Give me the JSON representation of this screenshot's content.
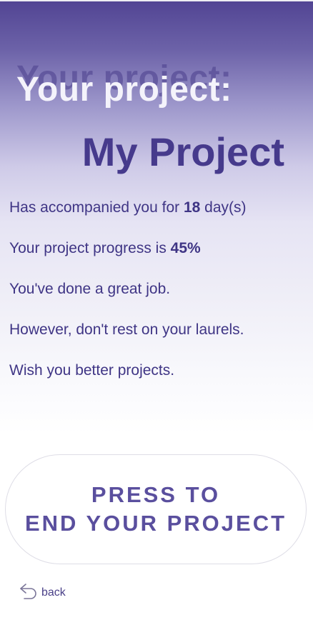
{
  "header": {
    "title": "Your project:",
    "project_name": "My Project"
  },
  "info": {
    "days_prefix": "Has accompanied you for ",
    "days_value": "18",
    "days_suffix": " day(s)",
    "progress_prefix": "Your project progress is ",
    "progress_value": "45%",
    "line_great_job": "You've done a great job.",
    "line_laurels": "However, don't rest on your laurels.",
    "line_wish": "Wish you better projects."
  },
  "end_button": {
    "line1": "PRESS TO",
    "line2": "END YOUR PROJECT"
  },
  "back": {
    "icon": "back-arrow-icon",
    "label": "back"
  },
  "colors": {
    "accent": "#463a8c",
    "gradient_top": "#514493",
    "button_text": "#5a4f9e"
  }
}
